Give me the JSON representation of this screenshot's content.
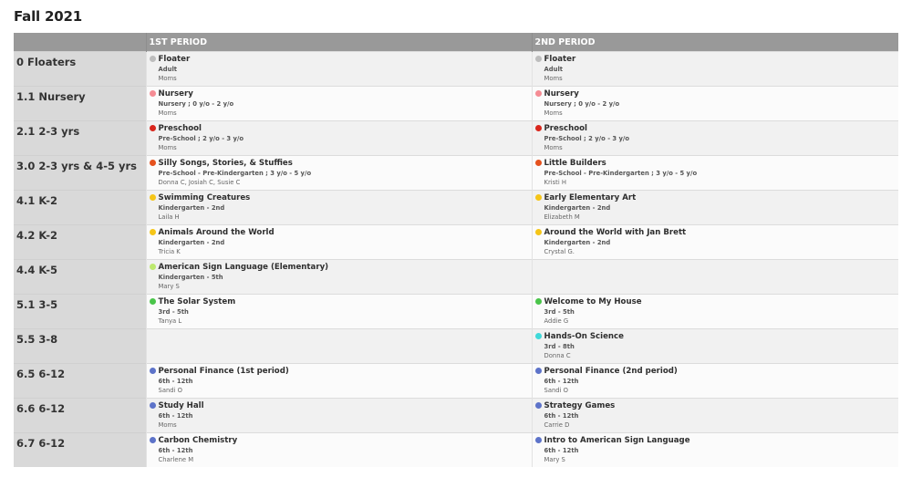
{
  "title": "Fall 2021",
  "headers": [
    "",
    "1ST PERIOD",
    "2ND PERIOD"
  ],
  "colors": {
    "grey": "#bdbdbd",
    "pink": "#f58c94",
    "red": "#d9261c",
    "orange": "#e5521e",
    "yellow": "#f5c518",
    "lime": "#bde96e",
    "green": "#4ac54a",
    "cyan": "#3fd9d9",
    "blue": "#5d73c9"
  },
  "rows": [
    {
      "room": "0 Floaters",
      "p1": {
        "name": "Floater",
        "grade": "Adult",
        "teacher": "Moms",
        "color": "#bdbdbd"
      },
      "p2": {
        "name": "Floater",
        "grade": "Adult",
        "teacher": "Moms",
        "color": "#bdbdbd"
      }
    },
    {
      "room": "1.1 Nursery",
      "p1": {
        "name": "Nursery",
        "grade": "Nursery ; 0 y/o - 2 y/o",
        "teacher": "Moms",
        "color": "#f58c94"
      },
      "p2": {
        "name": "Nursery",
        "grade": "Nursery ; 0 y/o - 2 y/o",
        "teacher": "Moms",
        "color": "#f58c94"
      }
    },
    {
      "room": "2.1 2-3 yrs",
      "p1": {
        "name": "Preschool",
        "grade": "Pre-School ; 2 y/o - 3 y/o",
        "teacher": "Moms",
        "color": "#d9261c"
      },
      "p2": {
        "name": "Preschool",
        "grade": "Pre-School ; 2 y/o - 3 y/o",
        "teacher": "Moms",
        "color": "#d9261c"
      }
    },
    {
      "room": "3.0 2-3 yrs & 4-5 yrs",
      "p1": {
        "name": "Silly Songs, Stories, & Stuffies",
        "grade": "Pre-School - Pre-Kindergarten ; 3 y/o - 5 y/o",
        "teacher": "Donna C, Josiah C, Susie C",
        "color": "#e5521e"
      },
      "p2": {
        "name": "Little Builders",
        "grade": "Pre-School - Pre-Kindergarten ; 3 y/o - 5 y/o",
        "teacher": "Kristi H",
        "color": "#e5521e"
      }
    },
    {
      "room": "4.1 K-2",
      "p1": {
        "name": "Swimming Creatures",
        "grade": "Kindergarten - 2nd",
        "teacher": "Laila H",
        "color": "#f5c518"
      },
      "p2": {
        "name": "Early Elementary Art",
        "grade": "Kindergarten - 2nd",
        "teacher": "Elizabeth M",
        "color": "#f5c518"
      }
    },
    {
      "room": "4.2 K-2",
      "p1": {
        "name": "Animals Around the World",
        "grade": "Kindergarten - 2nd",
        "teacher": "Tricia K",
        "color": "#f5c518"
      },
      "p2": {
        "name": "Around the World with Jan Brett",
        "grade": "Kindergarten - 2nd",
        "teacher": "Crystal G.",
        "color": "#f5c518"
      }
    },
    {
      "room": "4.4 K-5",
      "p1": {
        "name": "American Sign Language (Elementary)",
        "grade": "Kindergarten - 5th",
        "teacher": "Mary S",
        "color": "#bde96e"
      },
      "p2": null
    },
    {
      "room": "5.1 3-5",
      "p1": {
        "name": "The Solar System",
        "grade": "3rd - 5th",
        "teacher": "Tanya L",
        "color": "#4ac54a"
      },
      "p2": {
        "name": "Welcome to My House",
        "grade": "3rd - 5th",
        "teacher": "Addie G",
        "color": "#4ac54a"
      }
    },
    {
      "room": "5.5 3-8",
      "p1": null,
      "p2": {
        "name": "Hands-On Science",
        "grade": "3rd - 8th",
        "teacher": "Donna C",
        "color": "#3fd9d9"
      }
    },
    {
      "room": "6.5 6-12",
      "p1": {
        "name": "Personal Finance (1st period)",
        "grade": "6th - 12th",
        "teacher": "Sandi O",
        "color": "#5d73c9"
      },
      "p2": {
        "name": "Personal Finance (2nd period)",
        "grade": "6th - 12th",
        "teacher": "Sandi O",
        "color": "#5d73c9"
      }
    },
    {
      "room": "6.6 6-12",
      "p1": {
        "name": "Study Hall",
        "grade": "6th - 12th",
        "teacher": "Moms",
        "color": "#5d73c9"
      },
      "p2": {
        "name": "Strategy Games",
        "grade": "6th - 12th",
        "teacher": "Carrie D",
        "color": "#5d73c9"
      }
    },
    {
      "room": "6.7 6-12",
      "p1": {
        "name": "Carbon Chemistry",
        "grade": "6th - 12th",
        "teacher": "Charlene M",
        "color": "#5d73c9"
      },
      "p2": {
        "name": "Intro to American Sign Language",
        "grade": "6th - 12th",
        "teacher": "Mary S",
        "color": "#5d73c9"
      }
    }
  ]
}
